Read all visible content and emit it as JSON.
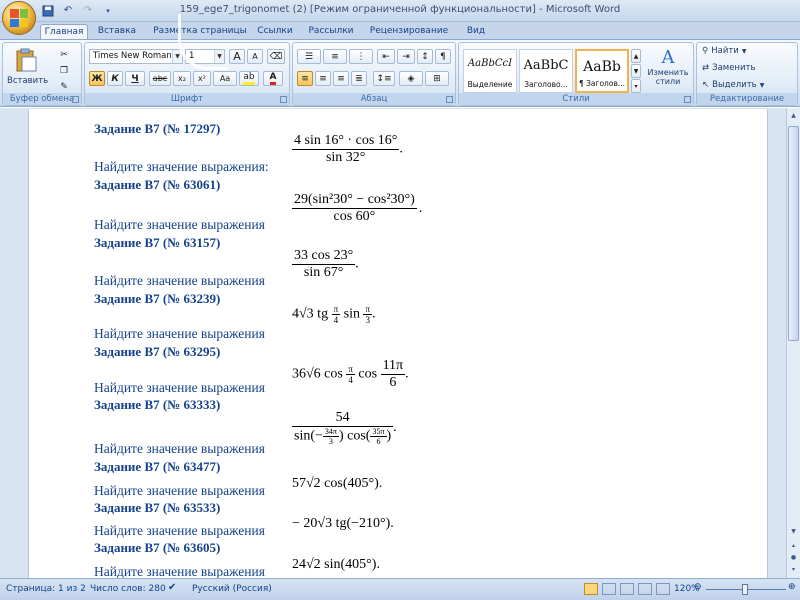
{
  "window": {
    "title": "159_ege7_trigonomet (2) [Режим ограниченной функциональности] - Microsoft Word"
  },
  "tabs": [
    "Главная",
    "Вставка",
    "Разметка страницы",
    "Ссылки",
    "Рассылки",
    "Рецензирование",
    "Вид"
  ],
  "ribbon": {
    "clipboard": {
      "label": "Буфер обмена",
      "paste": "Вставить"
    },
    "font": {
      "label": "Шрифт",
      "font_name": "Times New Roman",
      "font_size": "1",
      "bold": "Ж",
      "italic": "К",
      "underline": "Ч",
      "strike": "abc",
      "sub": "x₂",
      "sup": "x²",
      "case": "Aa",
      "grow": "A",
      "shrink": "A"
    },
    "paragraph": {
      "label": "Абзац"
    },
    "styles": {
      "label": "Стили",
      "cards": [
        {
          "sample": "AaBbCcI",
          "name": "Выделение"
        },
        {
          "sample": "AaBbC",
          "name": "Заголово..."
        },
        {
          "sample": "AaBb",
          "name": "¶ Заголов..."
        }
      ],
      "change_styles": "Изменить стили"
    },
    "editing": {
      "label": "Редактирование",
      "find": "Найти",
      "replace": "Заменить",
      "select": "Выделить"
    }
  },
  "tasks": [
    {
      "heading": "Задание B7 (№ 17297)",
      "prompt": "Найдите значение выражения:"
    },
    {
      "heading": "Задание B7 (№ 63061)",
      "prompt": "Найдите значение выражения"
    },
    {
      "heading": "Задание B7 (№ 63157)",
      "prompt": "Найдите значение выражения"
    },
    {
      "heading": "Задание B7 (№ 63239)",
      "prompt": "Найдите значение выражения"
    },
    {
      "heading": "Задание B7 (№ 63295)",
      "prompt": "Найдите значение выражения"
    },
    {
      "heading": "Задание B7 (№ 63333)",
      "prompt": "Найдите значение выражения"
    },
    {
      "heading": "Задание B7 (№ 63477)",
      "prompt": "Найдите значение выражения"
    },
    {
      "heading": "Задание B7 (№ 63533)",
      "prompt": "Найдите значение выражения"
    },
    {
      "heading": "Задание B7 (№ 63605)",
      "prompt": "Найдите значение выражения"
    }
  ],
  "formulas": {
    "f1": {
      "num": "4 sin 16° · cos 16°",
      "den": "sin 32°",
      "tail": "."
    },
    "f2": {
      "num": "29(sin²30° − cos²30°)",
      "den": "cos 60°",
      "tail": "."
    },
    "f3": {
      "num": "33 cos 23°",
      "den": "sin 67°",
      "tail": "."
    },
    "f4": {
      "lead": "4√3 tg",
      "n1": "π",
      "d1": "4",
      "mid": "sin",
      "n2": "π",
      "d2": "3",
      "tail": "."
    },
    "f5": {
      "lead": "36√6 cos",
      "n1": "π",
      "d1": "4",
      "mid": "cos",
      "n2": "11π",
      "d2": "6",
      "tail": "."
    },
    "f6": {
      "num": "54",
      "den_a": "sin(−",
      "den_an": "34π",
      "den_ad": "3",
      "den_b": ") cos(",
      "den_bn": "35π",
      "den_bd": "6",
      "den_c": ")",
      "tail": "."
    },
    "f7": {
      "text": "57√2 cos(405°)",
      "tail": "."
    },
    "f8": {
      "text": "− 20√3 tg(−210°)",
      "tail": "."
    },
    "f9": {
      "text": "24√2 sin(405°)",
      "tail": "."
    }
  },
  "status": {
    "page": "Страница: 1 из 2",
    "words": "Число слов: 280",
    "lang": "Русский (Россия)",
    "zoom": "120%"
  }
}
